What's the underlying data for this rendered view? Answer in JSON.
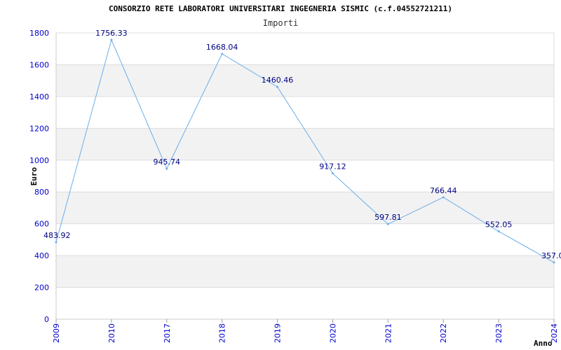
{
  "chart_data": {
    "type": "line",
    "title": "CONSORZIO RETE LABORATORI UNIVERSITARI INGEGNERIA SISMIC (c.f.04552721211)",
    "subtitle": "Importi",
    "xlabel": "Anno",
    "ylabel": "Euro",
    "categories": [
      "2009",
      "2010",
      "2017",
      "2018",
      "2019",
      "2020",
      "2021",
      "2022",
      "2023",
      "2024"
    ],
    "series": [
      {
        "values": [
          483.92,
          1756.33,
          945.74,
          1668.04,
          1460.46,
          917.12,
          597.81,
          766.44,
          552.05,
          357.0
        ],
        "labels": [
          "483.92",
          "1756.33",
          "945.74",
          "1668.04",
          "1460.46",
          "917.12",
          "597.81",
          "766.44",
          "552.05",
          "357.0"
        ]
      }
    ],
    "yticks": [
      "0",
      "200",
      "400",
      "600",
      "800",
      "1000",
      "1200",
      "1400",
      "1600",
      "1800"
    ],
    "ylim": [
      0,
      1800
    ],
    "grid": true,
    "colors": {
      "line": "#6aaeea",
      "band": "#f2f2f2",
      "tick": "#0000cc",
      "label": "#000080"
    }
  }
}
